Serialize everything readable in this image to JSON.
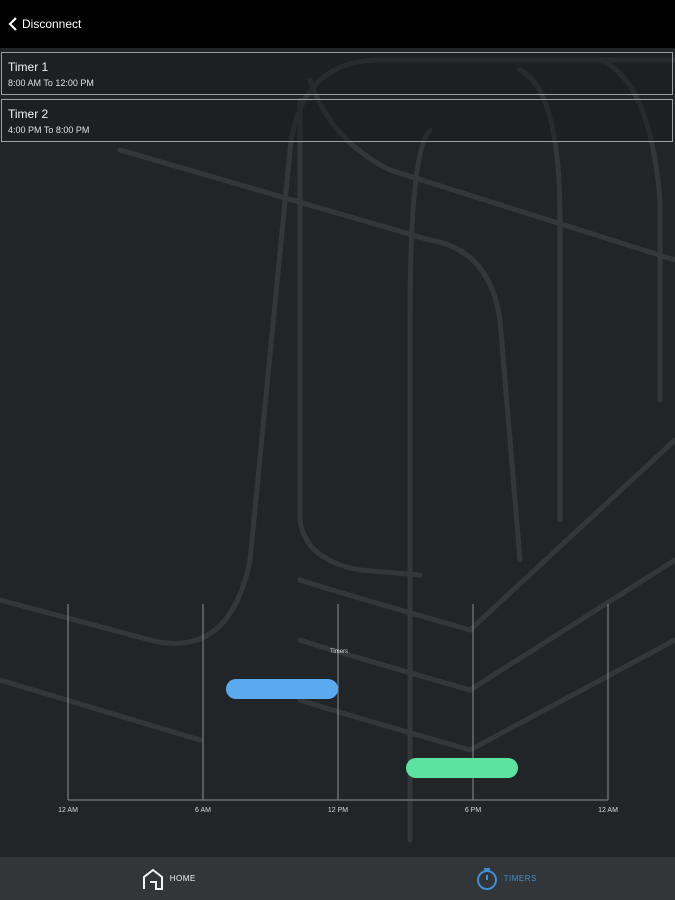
{
  "header": {
    "back_label": "Disconnect"
  },
  "timers": [
    {
      "title": "Timer 1",
      "range": "8:00 AM To 12:00 PM"
    },
    {
      "title": "Timer 2",
      "range": "4:00 PM To 8:00 PM"
    }
  ],
  "chart_data": {
    "type": "bar",
    "title": "Timers",
    "xlabel": "",
    "ylabel": "",
    "x_ticks": [
      "12 AM",
      "6 AM",
      "12 PM",
      "6 PM",
      "12 AM"
    ],
    "xlim": [
      0,
      24
    ],
    "grid": true,
    "series": [
      {
        "start": 8,
        "end": 12,
        "color": "#5aaaf0"
      },
      {
        "start": 16,
        "end": 20,
        "color": "#5ce3a0"
      }
    ]
  },
  "nav": {
    "home_label": "HOME",
    "timers_label": "TIMERS",
    "active_color": "#3f8fd6"
  }
}
